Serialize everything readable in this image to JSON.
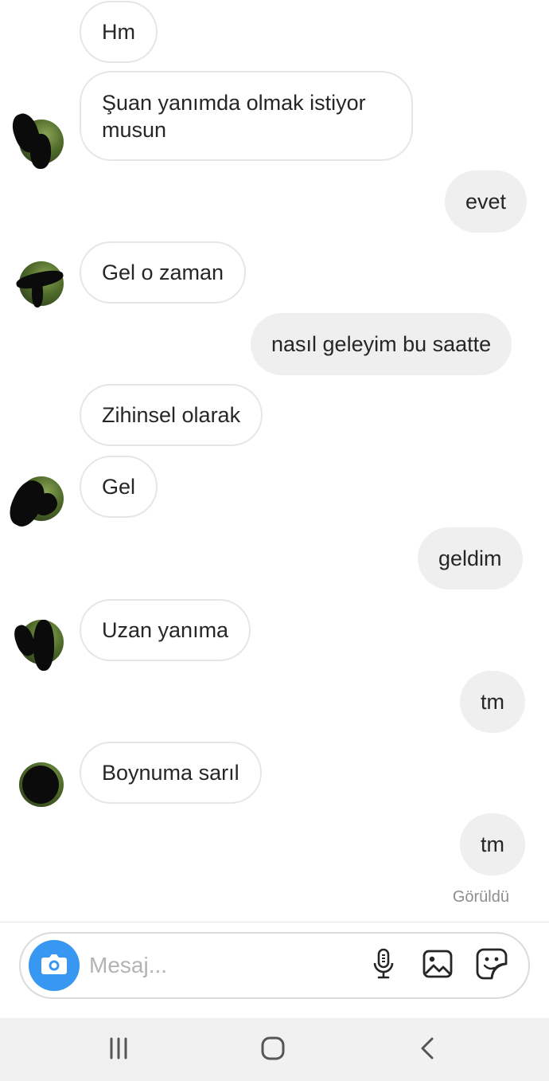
{
  "messages": [
    {
      "side": "in",
      "text": "Hm"
    },
    {
      "side": "in",
      "text": "Şuan yanımda olmak istiyor musun"
    },
    {
      "side": "out",
      "text": "evet"
    },
    {
      "side": "in",
      "text": "Gel o zaman"
    },
    {
      "side": "out",
      "text": "nasıl geleyim bu saatte"
    },
    {
      "side": "in",
      "text": "Zihinsel olarak"
    },
    {
      "side": "in",
      "text": "Gel"
    },
    {
      "side": "out",
      "text": "geldim"
    },
    {
      "side": "in",
      "text": "Uzan yanıma"
    },
    {
      "side": "out",
      "text": "tm"
    },
    {
      "side": "in",
      "text": "Boynuma sarıl"
    },
    {
      "side": "out",
      "text": "tm"
    }
  ],
  "seen_status": "Görüldü",
  "composer": {
    "placeholder": "Mesaj...",
    "camera_icon": "camera-icon",
    "mic_icon": "microphone-icon",
    "gallery_icon": "image-icon",
    "sticker_icon": "sticker-icon"
  },
  "navigation": {
    "recents_icon": "recent-apps-icon",
    "home_icon": "home-icon",
    "back_icon": "back-icon"
  },
  "colors": {
    "accent": "#3897f0",
    "outgoing_bubble": "#efefef",
    "incoming_border": "#e6e6e6"
  }
}
